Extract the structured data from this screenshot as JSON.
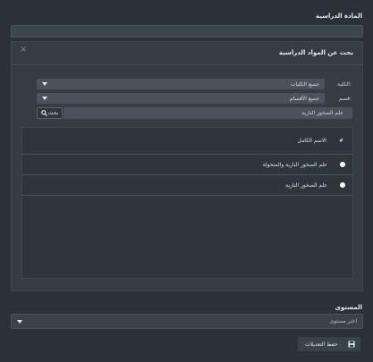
{
  "subjects": {
    "label": "المادة الدراسية"
  },
  "dialog": {
    "title": "بحث عن المواد الدراسية",
    "close_symbol": "×",
    "filters": {
      "college_label": "الكلية:",
      "college_value": "جميع الكليات",
      "department_label": "قسم:",
      "department_value": "جميع الأقسام",
      "search_value": "علم الصخور النارية",
      "search_button": "بحث"
    },
    "table": {
      "header_index": "#",
      "header_name": "الاسم الكامل",
      "rows": [
        {
          "name": "علم الصخور النارية والمتحولة"
        },
        {
          "name": "علم الصخور النارية"
        }
      ]
    }
  },
  "level": {
    "label": "المستوى",
    "placeholder": "اختر مستوى"
  },
  "save_button": {
    "label": "حفظ التعديلات"
  },
  "icons": {
    "search": "search-icon",
    "save": "floppy-disk-icon",
    "dropdown": "chevron-down-icon",
    "close": "close-icon"
  }
}
